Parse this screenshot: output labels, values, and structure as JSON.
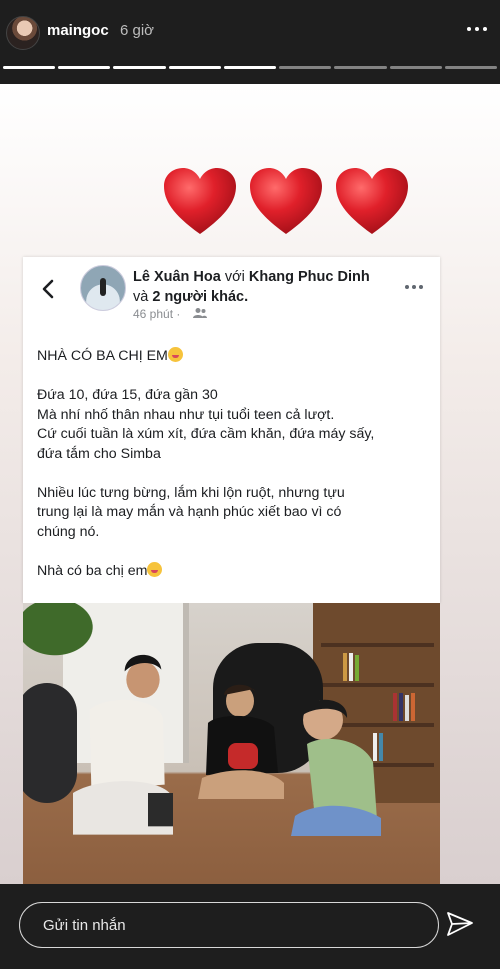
{
  "header": {
    "username": "maingoc",
    "time": "6 giờ",
    "progress": {
      "total_segments": 9,
      "viewed_segments": 5
    }
  },
  "post": {
    "author": "Lê Xuân Hoa",
    "with_text": "với",
    "tagged": "Khang Phuc Dinh",
    "and_text": "và",
    "others": "2 người khác.",
    "time": "46 phút",
    "separator": "·",
    "body": {
      "line1": "NHÀ CÓ BA CHỊ EM",
      "para2": [
        "Đứa 10, đứa 15, đứa gần 30",
        "Mà nhí nhố thân nhau như tụi tuổi teen cả lượt.",
        "Cứ cuối tuần là xúm xít, đứa cầm khăn, đứa máy sấy,",
        "đứa tắm cho Simba"
      ],
      "para3": [
        "Nhiều lúc tưng bừng, lắm khi lộn ruột, nhưng tựu",
        "trung lại là may mắn và hạnh phúc xiết bao vì có",
        "chúng nó."
      ],
      "last": "Nhà có ba chị em"
    }
  },
  "hearts_count": 3,
  "colors": {
    "heart": "#e0202a",
    "header_bg": "#1e1e1e"
  },
  "bottom": {
    "message_placeholder": "Gửi tin nhắn",
    "send_icon": "paper-plane-icon"
  }
}
